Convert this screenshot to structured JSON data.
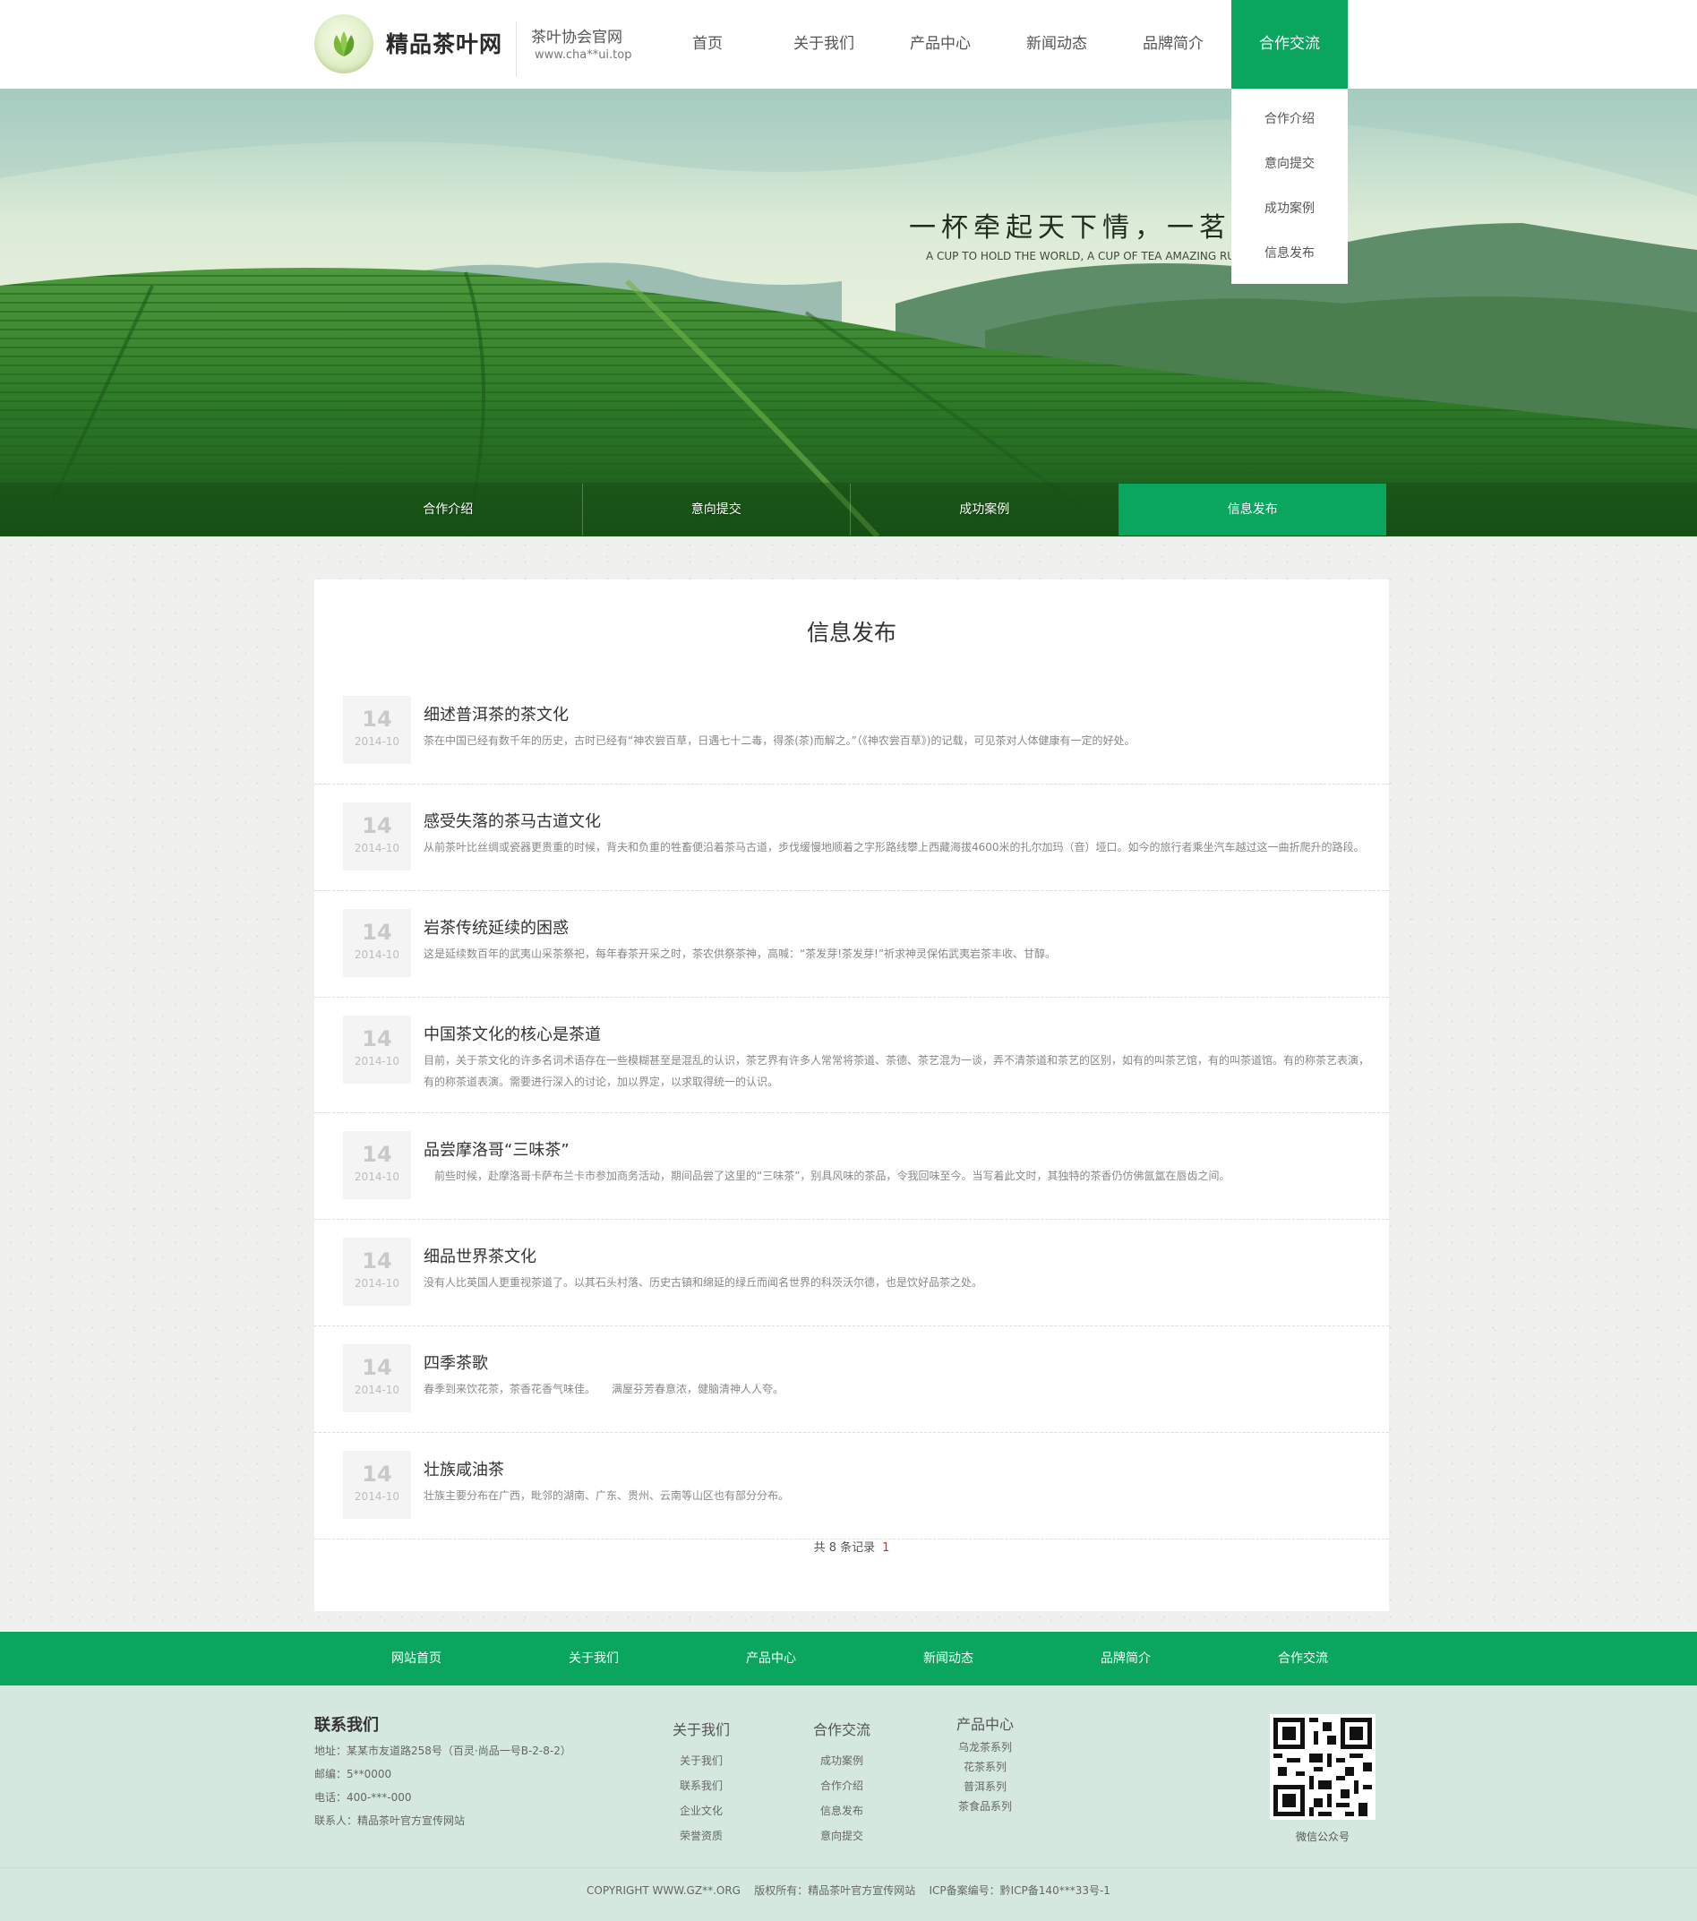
{
  "header": {
    "logo_text": "精品茶叶网",
    "sub_title": "茶叶协会官网",
    "sub_url": "www.cha**ui.top",
    "nav": [
      "首页",
      "关于我们",
      "产品中心",
      "新闻动态",
      "品牌简介",
      "合作交流"
    ],
    "active_nav_index": 5,
    "dropdown": [
      "合作介绍",
      "意向提交",
      "成功案例",
      "信息发布"
    ]
  },
  "banner": {
    "slogan_cn": "一杯牵起天下情，一茗惊人",
    "slogan_en": "A CUP TO HOLD THE WORLD, A CUP OF TEA AMAZING RUI",
    "subnav": [
      "合作介绍",
      "意向提交",
      "成功案例",
      "信息发布"
    ],
    "active_subnav_index": 3
  },
  "main": {
    "title": "信息发布",
    "items": [
      {
        "day": "14",
        "ym": "2014-10",
        "title": "细述普洱茶的茶文化",
        "desc": "茶在中国已经有数千年的历史，古时已经有“神农尝百草，日遇七十二毒，得荼(茶)而解之。”（《神农尝百草》)的记载，可见茶对人体健康有一定的好处。"
      },
      {
        "day": "14",
        "ym": "2014-10",
        "title": "感受失落的茶马古道文化",
        "desc": "从前茶叶比丝绸或瓷器更贵重的时候，背夫和负重的牲畜便沿着茶马古道，步伐缓慢地顺着之字形路线攀上西藏海拔4600米的扎尔加玛（音）垭口。如今的旅行者乘坐汽车越过这一曲折爬升的路段。"
      },
      {
        "day": "14",
        "ym": "2014-10",
        "title": "岩茶传统延续的困惑",
        "desc": "这是延续数百年的武夷山采茶祭祀，每年春茶开采之时，茶农供祭茶神，高喊：“茶发芽!茶发芽!”祈求神灵保佑武夷岩茶丰收、甘醇。"
      },
      {
        "day": "14",
        "ym": "2014-10",
        "title": "中国茶文化的核心是茶道",
        "desc": "目前，关于茶文化的许多名词术语存在一些模糊甚至是混乱的认识，茶艺界有许多人常常将茶道、茶德、茶艺混为一谈，弄不清茶道和茶艺的区别，如有的叫茶艺馆，有的叫茶道馆。有的称茶艺表演，有的称茶道表演。需要进行深入的讨论，加以界定，以求取得统一的认识。"
      },
      {
        "day": "14",
        "ym": "2014-10",
        "title": "品尝摩洛哥“三味茶”",
        "desc": "　前些时候，赴摩洛哥卡萨布兰卡市参加商务活动，期间品尝了这里的“三味茶”，别具风味的茶品，令我回味至今。当写着此文时，其独特的茶香仍仿佛氤氲在唇齿之间。"
      },
      {
        "day": "14",
        "ym": "2014-10",
        "title": "细品世界茶文化",
        "desc": "没有人比英国人更重视茶道了。以其石头村落、历史古镇和绵延的绿丘而闻名世界的科茨沃尔德，也是饮好品茶之处。"
      },
      {
        "day": "14",
        "ym": "2014-10",
        "title": "四季茶歌",
        "desc": "春季到来饮花茶，茶香花香气味佳。　　满屋芬芳春意浓，健脑清神人人夸。"
      },
      {
        "day": "14",
        "ym": "2014-10",
        "title": "壮族咸油茶",
        "desc": "壮族主要分布在广西，毗邻的湖南、广东、贵州、云南等山区也有部分分布。"
      }
    ],
    "pager_text": "共 8 条记录",
    "pager_page": "1"
  },
  "footnav": [
    "网站首页",
    "关于我们",
    "产品中心",
    "新闻动态",
    "品牌简介",
    "合作交流"
  ],
  "footer": {
    "contact_title": "联系我们",
    "address": "地址：某某市友道路258号（百灵·尚品一号B-2-8-2）",
    "postcode": "邮编：5**0000",
    "phone": "电话：400-***-000",
    "contact_person": "联系人：精品茶叶官方宣传网站",
    "col_about": {
      "title": "关于我们",
      "links": [
        "关于我们",
        "联系我们",
        "企业文化",
        "荣誉资质"
      ]
    },
    "col_coop": {
      "title": "合作交流",
      "links": [
        "成功案例",
        "合作介绍",
        "信息发布",
        "意向提交"
      ]
    },
    "col_products": {
      "title": "产品中心",
      "links": [
        "乌龙茶系列",
        "花茶系列",
        "普洱系列",
        "茶食品系列"
      ]
    },
    "qr_label": "微信公众号",
    "copyright": "COPYRIGHT WWW.GZ**.ORG    版权所有：精品茶叶官方宣传网站    ICP备案编号：黔ICP备140***33号-1"
  },
  "colors": {
    "brand_green": "#0aa65f",
    "footer_bg": "#d5e8df",
    "pager_red": "#e0262c"
  }
}
